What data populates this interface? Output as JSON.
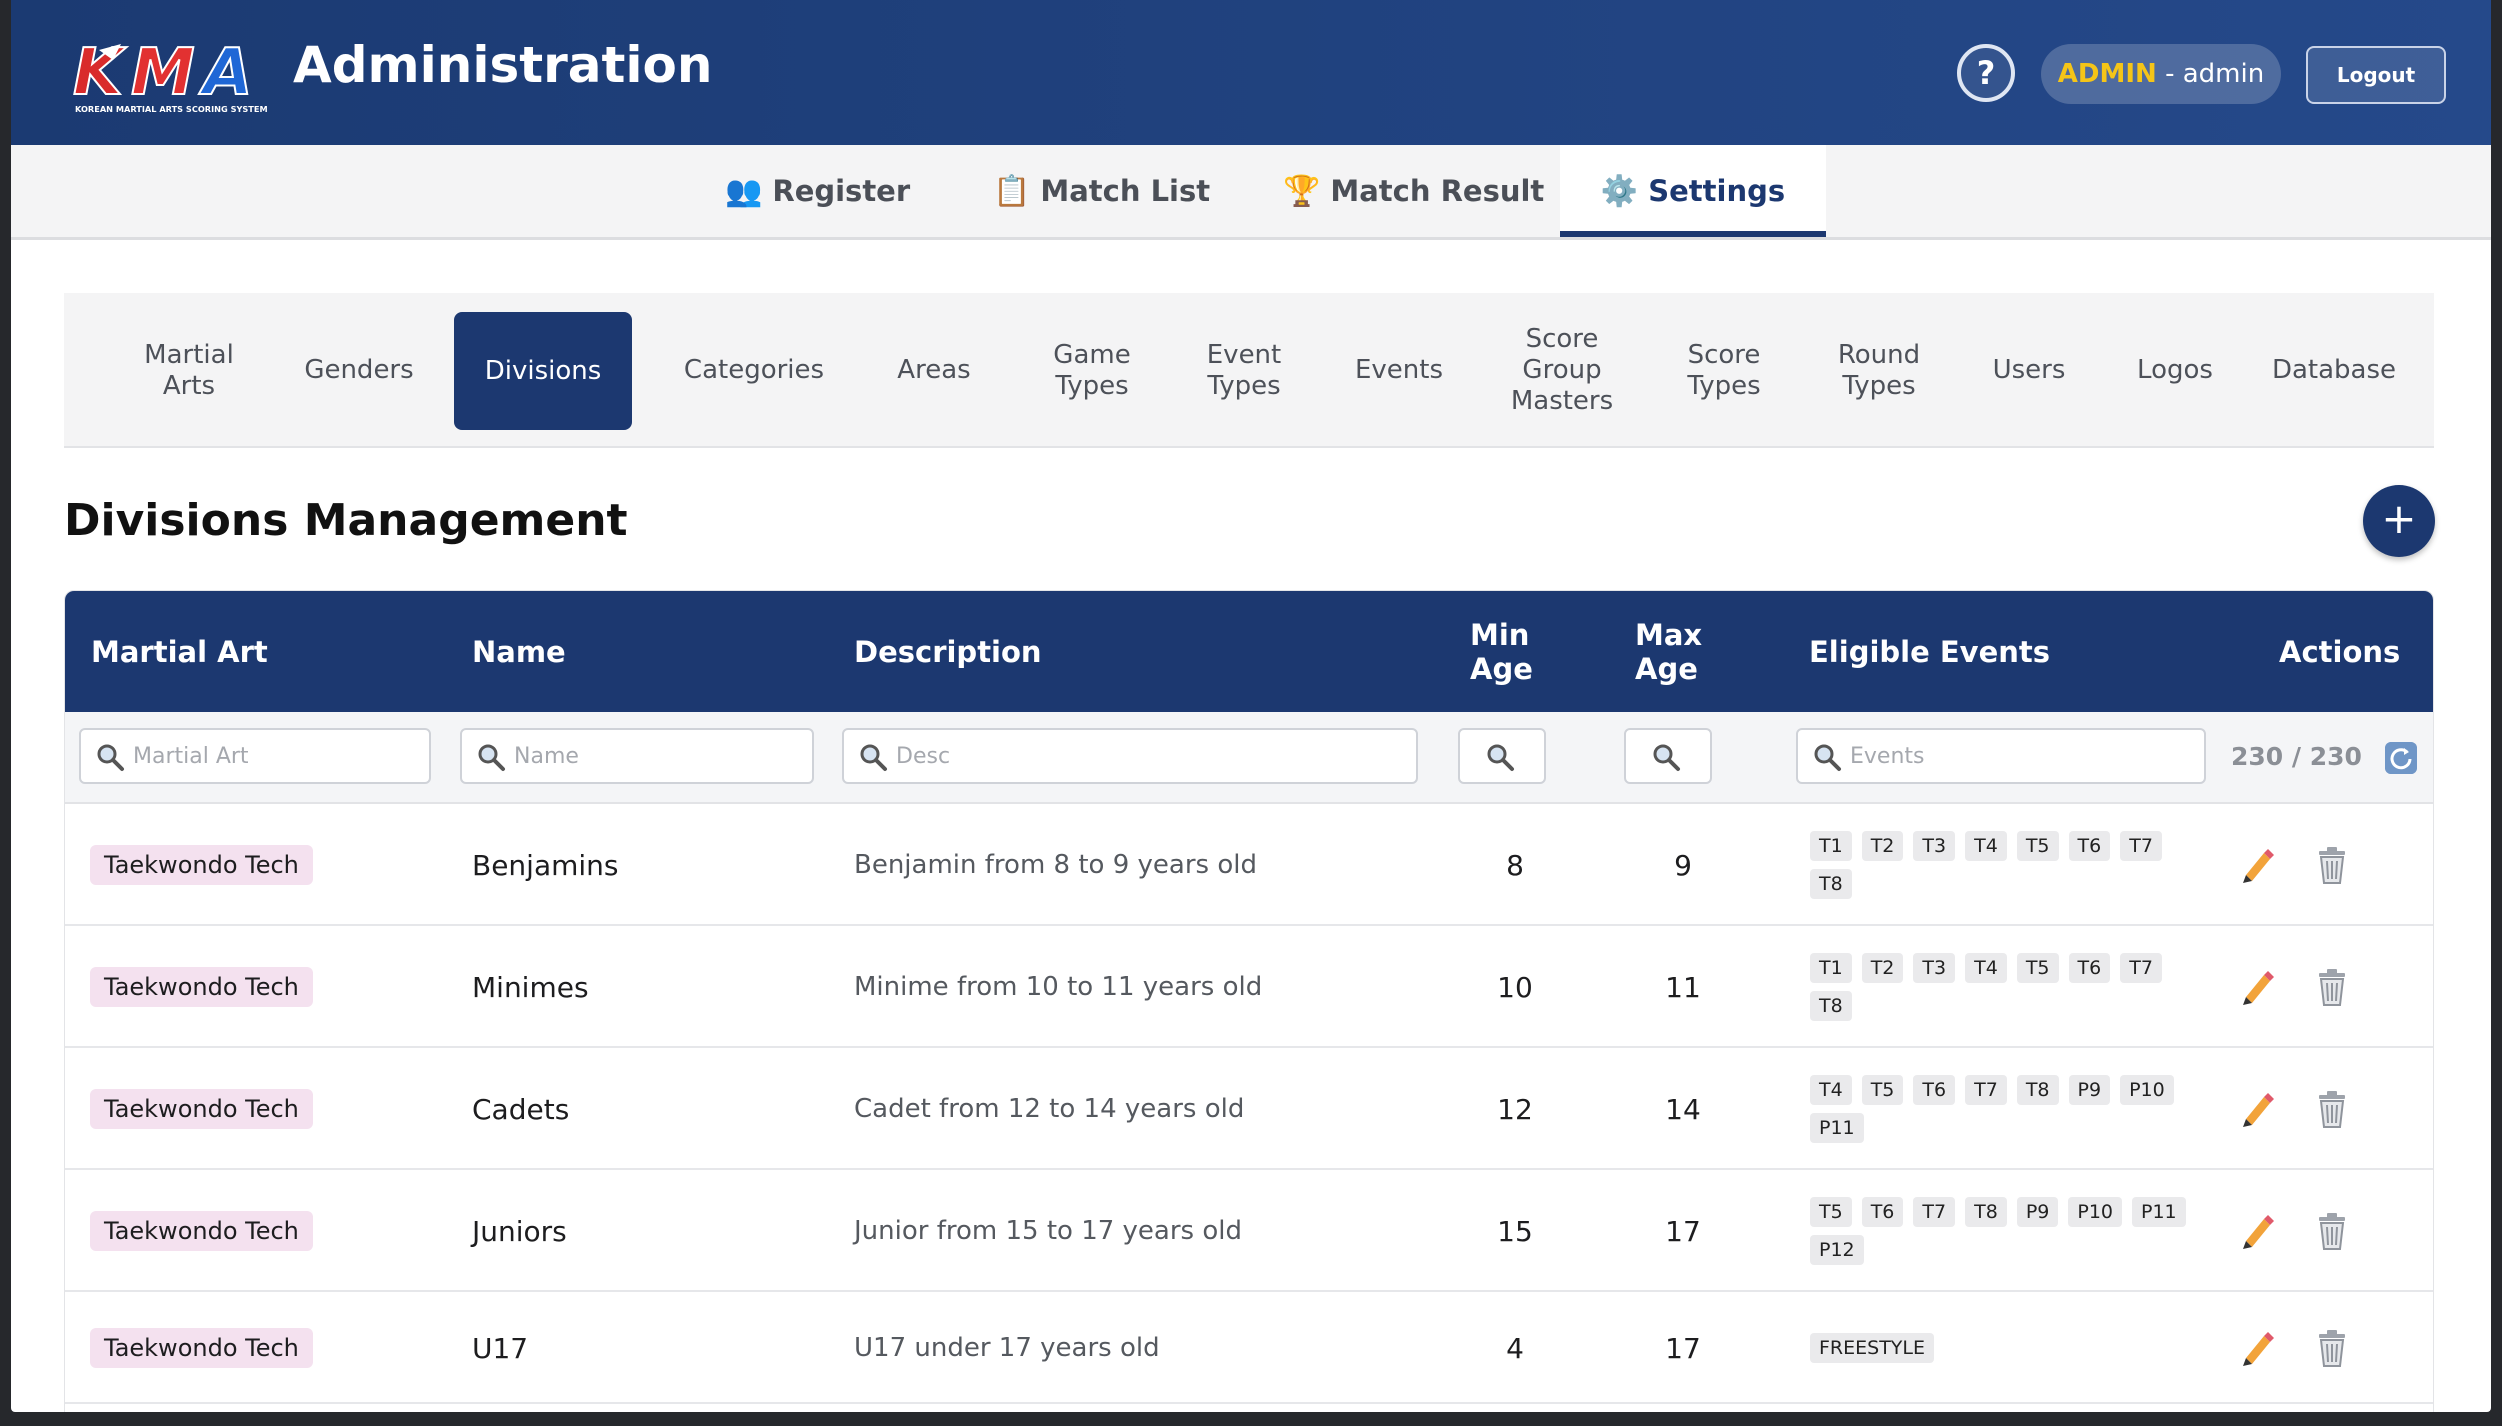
{
  "header": {
    "logo_text": "KMA",
    "logo_subtitle": "KOREAN MARTIAL ARTS SCORING SYSTEM",
    "title": "Administration",
    "help_label": "?",
    "user_role": "ADMIN",
    "user_separator": " - ",
    "user_name": "admin",
    "logout_label": "Logout"
  },
  "main_nav": [
    {
      "icon": "people-icon",
      "glyph": "👥",
      "label": "Register"
    },
    {
      "icon": "clipboard-icon",
      "glyph": "📋",
      "label": "Match List"
    },
    {
      "icon": "trophy-icon",
      "glyph": "🏆",
      "label": "Match Result"
    },
    {
      "icon": "gear-icon",
      "glyph": "⚙️",
      "label": "Settings",
      "active": true
    }
  ],
  "settings_tabs": [
    {
      "label": "Martial\nArts"
    },
    {
      "label": "Genders"
    },
    {
      "label": "Divisions",
      "active": true
    },
    {
      "label": "Categories"
    },
    {
      "label": "Areas"
    },
    {
      "label": "Game\nTypes"
    },
    {
      "label": "Event\nTypes"
    },
    {
      "label": "Events"
    },
    {
      "label": "Score\nGroup\nMasters"
    },
    {
      "label": "Score\nTypes"
    },
    {
      "label": "Round\nTypes"
    },
    {
      "label": "Users"
    },
    {
      "label": "Logos"
    },
    {
      "label": "Database"
    }
  ],
  "section": {
    "title": "Divisions Management",
    "add_label": "+"
  },
  "table": {
    "columns": {
      "martial_art": "Martial Art",
      "name": "Name",
      "description": "Description",
      "min_age": "Min\nAge",
      "max_age": "Max\nAge",
      "eligible_events": "Eligible Events",
      "actions": "Actions"
    },
    "filters": {
      "martial_art_placeholder": "Martial Art",
      "name_placeholder": "Name",
      "desc_placeholder": "Desc",
      "events_placeholder": "Events"
    },
    "count": "230 / 230",
    "rows": [
      {
        "martial_art": "Taekwondo Tech",
        "name": "Benjamins",
        "description": "Benjamin from 8 to 9 years old",
        "min_age": "8",
        "max_age": "9",
        "events": [
          "T1",
          "T2",
          "T3",
          "T4",
          "T5",
          "T6",
          "T7",
          "T8"
        ]
      },
      {
        "martial_art": "Taekwondo Tech",
        "name": "Minimes",
        "description": "Minime from 10 to 11 years old",
        "min_age": "10",
        "max_age": "11",
        "events": [
          "T1",
          "T2",
          "T3",
          "T4",
          "T5",
          "T6",
          "T7",
          "T8"
        ]
      },
      {
        "martial_art": "Taekwondo Tech",
        "name": "Cadets",
        "description": "Cadet from 12 to 14 years old",
        "min_age": "12",
        "max_age": "14",
        "events": [
          "T4",
          "T5",
          "T6",
          "T7",
          "T8",
          "P9",
          "P10",
          "P11"
        ]
      },
      {
        "martial_art": "Taekwondo Tech",
        "name": "Juniors",
        "description": "Junior from 15 to 17 years old",
        "min_age": "15",
        "max_age": "17",
        "events": [
          "T5",
          "T6",
          "T7",
          "T8",
          "P9",
          "P10",
          "P11",
          "P12"
        ]
      },
      {
        "martial_art": "Taekwondo Tech",
        "name": "U17",
        "description": "U17 under 17 years old",
        "min_age": "4",
        "max_age": "17",
        "events": [
          "FREESTYLE"
        ]
      }
    ]
  },
  "colors": {
    "primary": "#1c3870",
    "header_gradient_end": "#25498a",
    "role_accent": "#f5c518",
    "badge_bg": "#f4e1ef"
  }
}
